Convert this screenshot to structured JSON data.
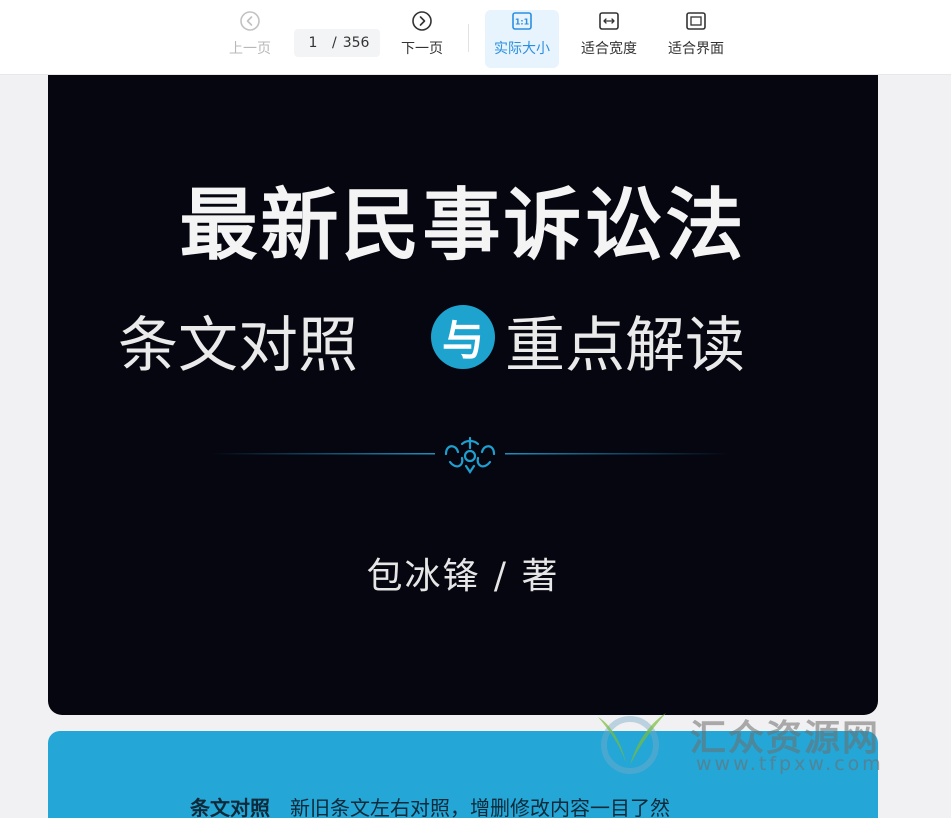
{
  "toolbar": {
    "prev_label": "上一页",
    "next_label": "下一页",
    "current_page": "1",
    "page_separator": "/",
    "total_pages": "356",
    "actual_size_label": "实际大小",
    "actual_size_icon_text": "1:1",
    "fit_width_label": "适合宽度",
    "fit_page_label": "适合界面"
  },
  "cover": {
    "title": "最新民事诉讼法",
    "subtitle_left": "条文对照",
    "subtitle_connector": "与",
    "subtitle_right": "重点解读",
    "author": "包冰锋 / 著",
    "feature_label": "条文对照",
    "feature_text": "新旧条文左右对照，增删修改内容一目了然"
  },
  "watermark": {
    "name": "汇众资源网",
    "url": "www.tfpxw.com"
  },
  "colors": {
    "accent": "#2b8fe0",
    "cover_dark": "#05060f",
    "cover_blue": "#24a6d6",
    "badge": "#1ea3cf"
  }
}
